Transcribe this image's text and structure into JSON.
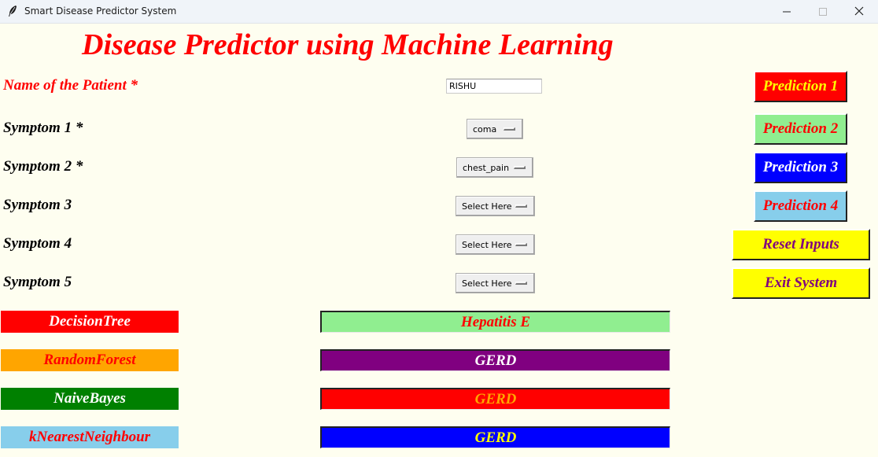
{
  "window": {
    "title": "Smart Disease Predictor System",
    "icon": "feather-icon",
    "controls": [
      "minimize-icon",
      "maximize-icon",
      "close-icon"
    ]
  },
  "heading": "Disease Predictor using Machine Learning",
  "patient": {
    "label": "Name of the Patient *",
    "value": "RISHU"
  },
  "symptoms": [
    {
      "label": "Symptom 1 *",
      "value": "coma"
    },
    {
      "label": "Symptom 2 *",
      "value": "chest_pain"
    },
    {
      "label": "Symptom 3",
      "value": "Select Here"
    },
    {
      "label": "Symptom 4",
      "value": "Select Here"
    },
    {
      "label": "Symptom 5",
      "value": "Select Here"
    }
  ],
  "buttons": {
    "prediction1": {
      "label": "Prediction 1",
      "bg": "#ff0000",
      "fg": "#ffff00"
    },
    "prediction2": {
      "label": "Prediction 2",
      "bg": "#90ee90",
      "fg": "#ff0000"
    },
    "prediction3": {
      "label": "Prediction 3",
      "bg": "#0000ff",
      "fg": "#ffffff"
    },
    "prediction4": {
      "label": "Prediction 4",
      "bg": "#87ceeb",
      "fg": "#ff0000"
    },
    "reset": {
      "label": "Reset Inputs",
      "bg": "#ffff00",
      "fg": "#800080"
    },
    "exit": {
      "label": "Exit System",
      "bg": "#ffff00",
      "fg": "#800080"
    }
  },
  "algorithms": [
    {
      "name": "DecisionTree",
      "bg": "#ff0000",
      "fg": "#ffffff",
      "result": "Hepatitis E",
      "result_bg": "#90ee90",
      "result_fg": "#ff0000"
    },
    {
      "name": "RandomForest",
      "bg": "#ffa500",
      "fg": "#ff0000",
      "result": "GERD",
      "result_bg": "#800080",
      "result_fg": "#ffffff"
    },
    {
      "name": "NaiveBayes",
      "bg": "#008000",
      "fg": "#ffffff",
      "result": "GERD",
      "result_bg": "#ff0000",
      "result_fg": "#ffa500"
    },
    {
      "name": "kNearestNeighbour",
      "bg": "#87ceeb",
      "fg": "#ff0000",
      "result": "GERD",
      "result_bg": "#0000ff",
      "result_fg": "#ffff00"
    }
  ]
}
